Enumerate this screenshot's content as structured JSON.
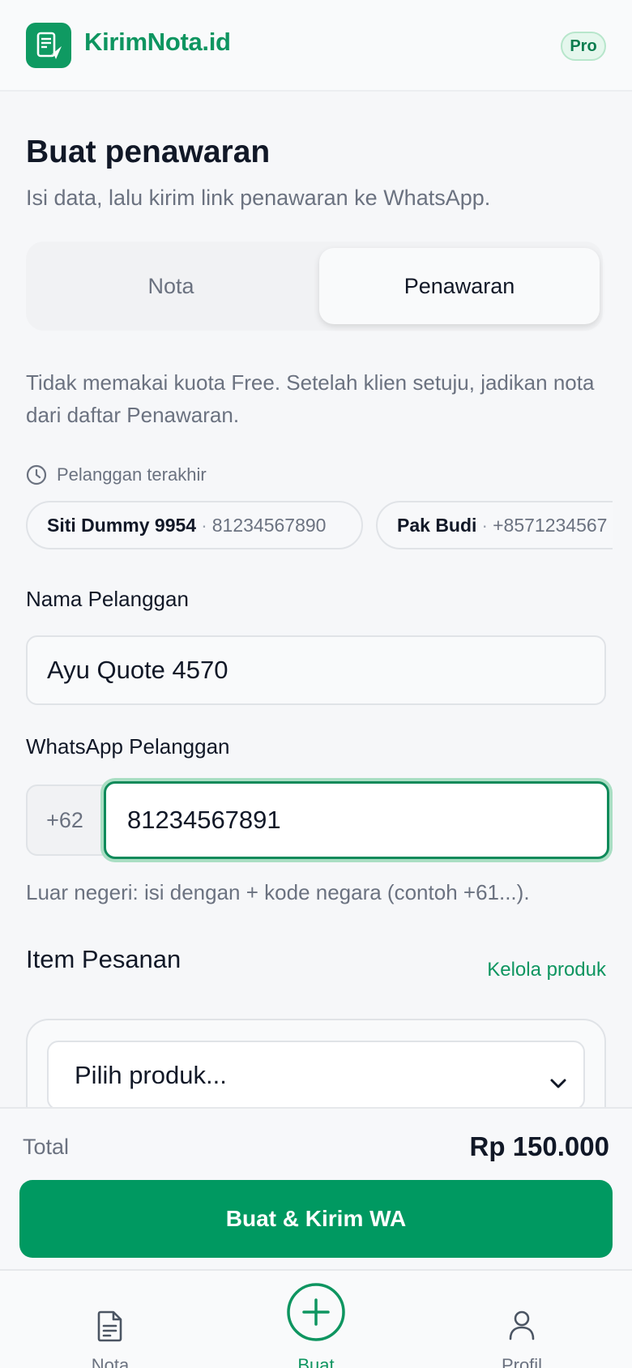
{
  "brand": {
    "name": "KirimNota.id",
    "badge": "Pro",
    "color": "#0e9560"
  },
  "header": {
    "title": "Buat penawaran",
    "subtitle": "Isi data, lalu kirim link penawaran ke WhatsApp."
  },
  "segment": {
    "options": [
      "Nota",
      "Penawaran"
    ],
    "selected": "Penawaran"
  },
  "info_text": "Tidak memakai kuota Free. Setelah klien setuju, jadikan nota dari daftar Penawaran.",
  "recent": {
    "label": "Pelanggan terakhir",
    "icon": "clock-icon",
    "customers": [
      {
        "name": "Siti Dummy 9954",
        "sep": "·",
        "phone": "81234567890"
      },
      {
        "name": "Pak Budi",
        "sep": "·",
        "phone": "+8571234567"
      }
    ]
  },
  "form": {
    "customer_name_label": "Nama Pelanggan",
    "customer_name_value": "Ayu Quote 4570",
    "whatsapp_label": "WhatsApp Pelanggan",
    "country_code": "+62",
    "whatsapp_value": "81234567891",
    "whatsapp_hint": "Luar negeri: isi dengan + kode negara (contoh +61...)."
  },
  "items": {
    "title": "Item Pesanan",
    "manage_link": "Kelola produk",
    "select_value": "Pilih produk..."
  },
  "summary": {
    "total_label": "Total",
    "total_value": "Rp 150.000"
  },
  "cta": {
    "label": "Buat & Kirim WA",
    "color": "#009961"
  },
  "tabbar": {
    "items": [
      {
        "label": "Nota",
        "icon": "document-icon",
        "active": false
      },
      {
        "label": "Buat",
        "icon": "plus-circle-icon",
        "active": true
      },
      {
        "label": "Profil",
        "icon": "user-icon",
        "active": false
      }
    ]
  }
}
